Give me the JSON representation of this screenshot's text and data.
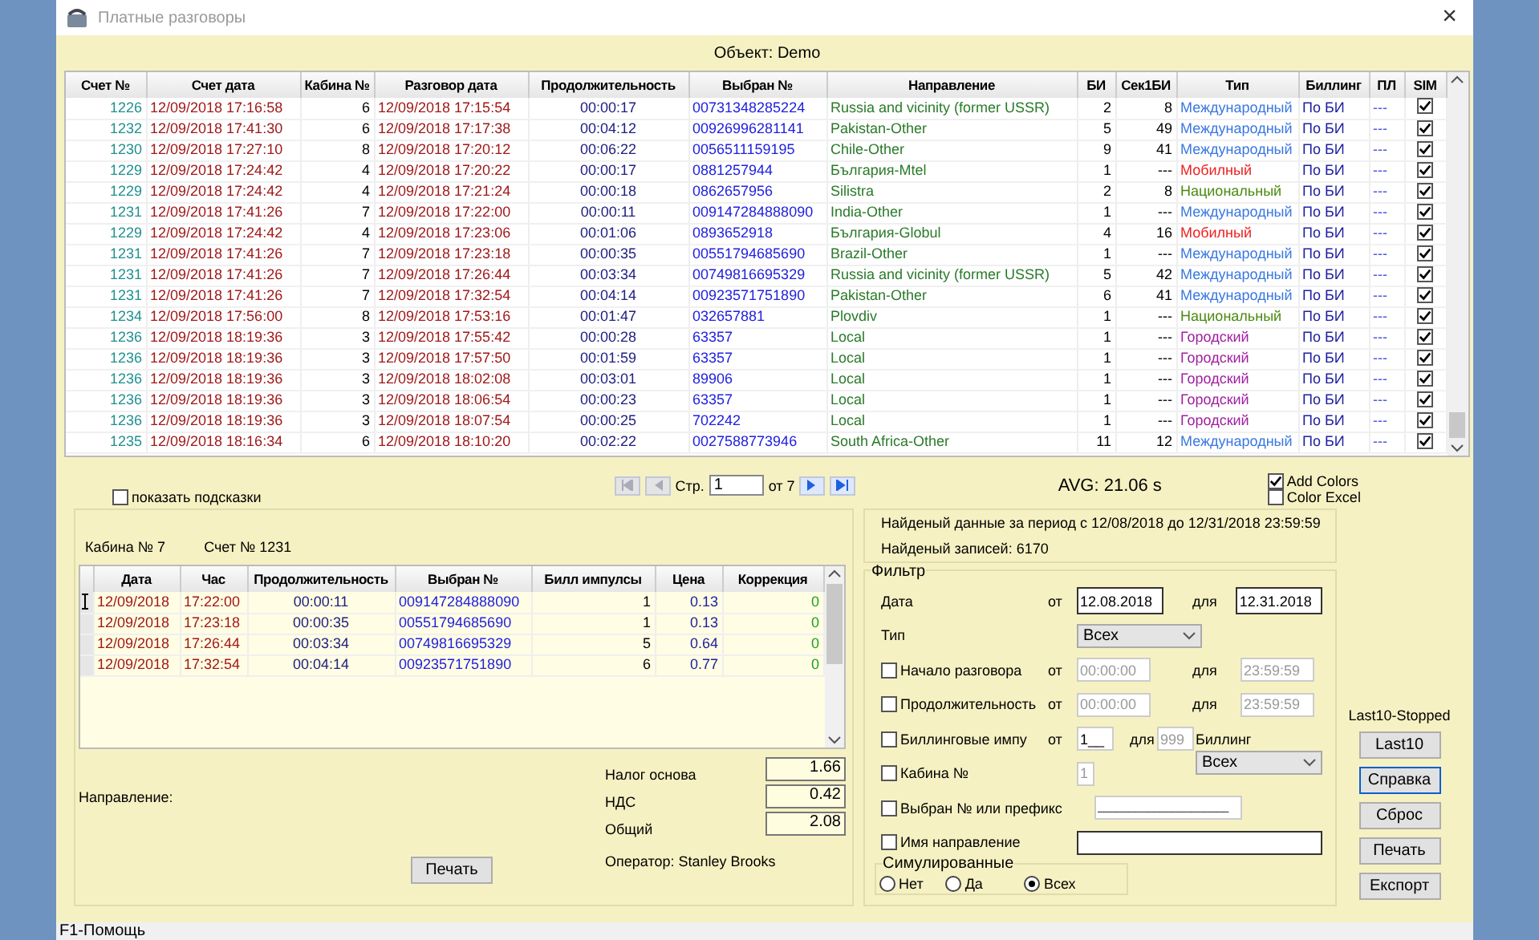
{
  "window": {
    "title": "Платные разговоры",
    "close": "×"
  },
  "object_label": "Объект: Demo",
  "calls_table": {
    "columns": [
      "Счет №",
      "Счет дата",
      "Кабина №",
      "Разговор дата",
      "Продолжительность",
      "Выбран №",
      "Направление",
      "БИ",
      "Сек1БИ",
      "Тип",
      "Биллинг",
      "ПЛ",
      "SIM"
    ],
    "rows": [
      {
        "account": "1226",
        "account_date": "12/09/2018  17:16:58",
        "booth": "6",
        "call_date": "12/09/2018  17:15:54",
        "duration": "00:00:17",
        "dialed": "00731348285224",
        "direction": "Russia and vicinity (former USSR)",
        "bi": "2",
        "sec1bi": "8",
        "type": "Международный",
        "color": "#3a78e0",
        "billing": "По БИ",
        "pl": "---",
        "sim_checked": true
      },
      {
        "account": "1232",
        "account_date": "12/09/2018  17:41:30",
        "booth": "6",
        "call_date": "12/09/2018  17:17:38",
        "duration": "00:04:12",
        "dialed": "00926996281141",
        "direction": "Pakistan-Other",
        "bi": "5",
        "sec1bi": "49",
        "type": "Международный",
        "color": "#3a78e0",
        "billing": "По БИ",
        "pl": "---",
        "sim_checked": true
      },
      {
        "account": "1230",
        "account_date": "12/09/2018  17:27:10",
        "booth": "8",
        "call_date": "12/09/2018  17:20:12",
        "duration": "00:06:22",
        "dialed": "0056511159195",
        "direction": "Chile-Other",
        "bi": "9",
        "sec1bi": "41",
        "type": "Международный",
        "color": "#3a78e0",
        "billing": "По БИ",
        "pl": "---",
        "sim_checked": true
      },
      {
        "account": "1229",
        "account_date": "12/09/2018  17:24:42",
        "booth": "4",
        "call_date": "12/09/2018  17:20:22",
        "duration": "00:00:17",
        "dialed": "0881257944",
        "direction": "България-Mtel",
        "bi": "1",
        "sec1bi": "---",
        "type": "Мобилный",
        "color": "#f02020",
        "billing": "По БИ",
        "pl": "---",
        "sim_checked": true
      },
      {
        "account": "1229",
        "account_date": "12/09/2018  17:24:42",
        "booth": "4",
        "call_date": "12/09/2018  17:21:24",
        "duration": "00:00:18",
        "dialed": "0862657956",
        "direction": "Silistra",
        "bi": "2",
        "sec1bi": "8",
        "type": "Национальный",
        "color": "#4a8a10",
        "billing": "По БИ",
        "pl": "---",
        "sim_checked": true
      },
      {
        "account": "1231",
        "account_date": "12/09/2018  17:41:26",
        "booth": "7",
        "call_date": "12/09/2018  17:22:00",
        "duration": "00:00:11",
        "dialed": "009147284888090",
        "direction": "India-Other",
        "bi": "1",
        "sec1bi": "---",
        "type": "Международный",
        "color": "#3a78e0",
        "billing": "По БИ",
        "pl": "---",
        "sim_checked": true
      },
      {
        "account": "1229",
        "account_date": "12/09/2018  17:24:42",
        "booth": "4",
        "call_date": "12/09/2018  17:23:06",
        "duration": "00:01:06",
        "dialed": "0893652918",
        "direction": "България-Globul",
        "bi": "4",
        "sec1bi": "16",
        "type": "Мобилный",
        "color": "#f02020",
        "billing": "По БИ",
        "pl": "---",
        "sim_checked": true
      },
      {
        "account": "1231",
        "account_date": "12/09/2018  17:41:26",
        "booth": "7",
        "call_date": "12/09/2018  17:23:18",
        "duration": "00:00:35",
        "dialed": "00551794685690",
        "direction": "Brazil-Other",
        "bi": "1",
        "sec1bi": "---",
        "type": "Международный",
        "color": "#3a78e0",
        "billing": "По БИ",
        "pl": "---",
        "sim_checked": true
      },
      {
        "account": "1231",
        "account_date": "12/09/2018  17:41:26",
        "booth": "7",
        "call_date": "12/09/2018  17:26:44",
        "duration": "00:03:34",
        "dialed": "00749816695329",
        "direction": "Russia and vicinity (former USSR)",
        "bi": "5",
        "sec1bi": "42",
        "type": "Международный",
        "color": "#3a78e0",
        "billing": "По БИ",
        "pl": "---",
        "sim_checked": true
      },
      {
        "account": "1231",
        "account_date": "12/09/2018  17:41:26",
        "booth": "7",
        "call_date": "12/09/2018  17:32:54",
        "duration": "00:04:14",
        "dialed": "00923571751890",
        "direction": "Pakistan-Other",
        "bi": "6",
        "sec1bi": "41",
        "type": "Международный",
        "color": "#3a78e0",
        "billing": "По БИ",
        "pl": "---",
        "sim_checked": true
      },
      {
        "account": "1234",
        "account_date": "12/09/2018  17:56:00",
        "booth": "8",
        "call_date": "12/09/2018  17:53:16",
        "duration": "00:01:47",
        "dialed": "032657881",
        "direction": "Plovdiv",
        "bi": "1",
        "sec1bi": "---",
        "type": "Национальный",
        "color": "#4a8a10",
        "billing": "По БИ",
        "pl": "---",
        "sim_checked": true
      },
      {
        "account": "1236",
        "account_date": "12/09/2018  18:19:36",
        "booth": "3",
        "call_date": "12/09/2018  17:55:42",
        "duration": "00:00:28",
        "dialed": "63357",
        "direction": "Local",
        "bi": "1",
        "sec1bi": "---",
        "type": "Городский",
        "color": "#a020a0",
        "billing": "По БИ",
        "pl": "---",
        "sim_checked": true
      },
      {
        "account": "1236",
        "account_date": "12/09/2018  18:19:36",
        "booth": "3",
        "call_date": "12/09/2018  17:57:50",
        "duration": "00:01:59",
        "dialed": "63357",
        "direction": "Local",
        "bi": "1",
        "sec1bi": "---",
        "type": "Городский",
        "color": "#a020a0",
        "billing": "По БИ",
        "pl": "---",
        "sim_checked": true
      },
      {
        "account": "1236",
        "account_date": "12/09/2018  18:19:36",
        "booth": "3",
        "call_date": "12/09/2018  18:02:08",
        "duration": "00:03:01",
        "dialed": "89906",
        "direction": "Local",
        "bi": "1",
        "sec1bi": "---",
        "type": "Городский",
        "color": "#a020a0",
        "billing": "По БИ",
        "pl": "---",
        "sim_checked": true
      },
      {
        "account": "1236",
        "account_date": "12/09/2018  18:19:36",
        "booth": "3",
        "call_date": "12/09/2018  18:06:54",
        "duration": "00:00:23",
        "dialed": "63357",
        "direction": "Local",
        "bi": "1",
        "sec1bi": "---",
        "type": "Городский",
        "color": "#a020a0",
        "billing": "По БИ",
        "pl": "---",
        "sim_checked": true
      },
      {
        "account": "1236",
        "account_date": "12/09/2018  18:19:36",
        "booth": "3",
        "call_date": "12/09/2018  18:07:54",
        "duration": "00:00:25",
        "dialed": "702242",
        "direction": "Local",
        "bi": "1",
        "sec1bi": "---",
        "type": "Городский",
        "color": "#a020a0",
        "billing": "По БИ",
        "pl": "---",
        "sim_checked": true
      },
      {
        "account": "1235",
        "account_date": "12/09/2018  18:16:34",
        "booth": "6",
        "call_date": "12/09/2018  18:10:20",
        "duration": "00:02:22",
        "dialed": "0027588773946",
        "direction": "South Africa-Other",
        "bi": "11",
        "sec1bi": "12",
        "type": "Международный",
        "color": "#3a78e0",
        "billing": "По БИ",
        "pl": "---",
        "sim_checked": true
      }
    ]
  },
  "hints": {
    "label": "показать подсказки",
    "checked": false
  },
  "pager": {
    "page_label": "Стр.",
    "page": "1",
    "of_label": "от 7"
  },
  "avg": "AVG:  21.06 s",
  "options": [
    {
      "label": "Add Colors",
      "checked": true
    },
    {
      "label": "Color Excel",
      "checked": false
    }
  ],
  "detail": {
    "booth": "Кабина № 7",
    "account": "Счет № 1231",
    "columns": [
      "Дата",
      "Час",
      "Продолжительность",
      "Выбран №",
      "Билл импулсы",
      "Цена",
      "Коррекция"
    ],
    "rows": [
      {
        "selected": true,
        "date": "12/09/2018",
        "time": "17:22:00",
        "duration": "00:00:11",
        "dialed": "009147284888090",
        "impulses": "1",
        "price": "0.13",
        "correction": "0"
      },
      {
        "selected": false,
        "date": "12/09/2018",
        "time": "17:23:18",
        "duration": "00:00:35",
        "dialed": "00551794685690",
        "impulses": "1",
        "price": "0.13",
        "correction": "0"
      },
      {
        "selected": false,
        "date": "12/09/2018",
        "time": "17:26:44",
        "duration": "00:03:34",
        "dialed": "00749816695329",
        "impulses": "5",
        "price": "0.64",
        "correction": "0"
      },
      {
        "selected": false,
        "date": "12/09/2018",
        "time": "17:32:54",
        "duration": "00:04:14",
        "dialed": "00923571751890",
        "impulses": "6",
        "price": "0.77",
        "correction": "0"
      }
    ],
    "direction_label": "Направление:",
    "totals": [
      {
        "label": "Налог основа",
        "value": "1.66"
      },
      {
        "label": "НДС",
        "value": "0.42"
      },
      {
        "label": "Общий",
        "value": "2.08"
      }
    ],
    "print": "Печать",
    "operator": "Оператор: Stanley Brooks"
  },
  "info": {
    "period": "Найденый данные за период с 12/08/2018  до 12/31/2018 23:59:59",
    "count": "Найденый записей: 6170"
  },
  "filter": {
    "title": "Фильтр",
    "date": {
      "label": "Дата",
      "from_label": "от",
      "from": "12.08.2018",
      "to_label": "для",
      "to": "12.31.2018"
    },
    "type": {
      "label": "Тип",
      "value": "Всех"
    },
    "rows": [
      {
        "kind": "range",
        "label": "Начало разговора",
        "checked": false,
        "from_label": "от",
        "from": "00:00:00",
        "to_label": "для",
        "to": "23:59:59"
      },
      {
        "kind": "range",
        "label": "Продолжительность",
        "checked": false,
        "from_label": "от",
        "from": "00:00:00",
        "to_label": "для",
        "to": "23:59:59"
      },
      {
        "kind": "impulses",
        "label": "Биллинговые  импу",
        "checked": false,
        "from_label": "от",
        "from": "1__",
        "to_label": "для",
        "to": "999",
        "billing_label": "Биллинг",
        "billing": "Всех"
      },
      {
        "kind": "short",
        "label": "Кабина №",
        "checked": false,
        "value": "1"
      },
      {
        "kind": "medium",
        "label": "Выбран №  или префикс",
        "checked": false,
        "value": "_____________________"
      },
      {
        "kind": "wide",
        "label": "Имя направление",
        "checked": false
      }
    ],
    "simulated": {
      "title": "Симулированные",
      "options": [
        {
          "label": "Нет",
          "selected": false
        },
        {
          "label": "Да",
          "selected": false
        },
        {
          "label": "Всех",
          "selected": true
        }
      ]
    }
  },
  "side": {
    "status": "Last10-Stopped",
    "buttons": [
      {
        "label": "Last10",
        "focused": false
      },
      {
        "label": "Справка",
        "focused": true
      },
      {
        "label": "Сброс",
        "focused": false
      },
      {
        "label": "Печать",
        "focused": false
      },
      {
        "label": "Експорт",
        "focused": false
      }
    ]
  },
  "status_bar": "F1-Помощь"
}
